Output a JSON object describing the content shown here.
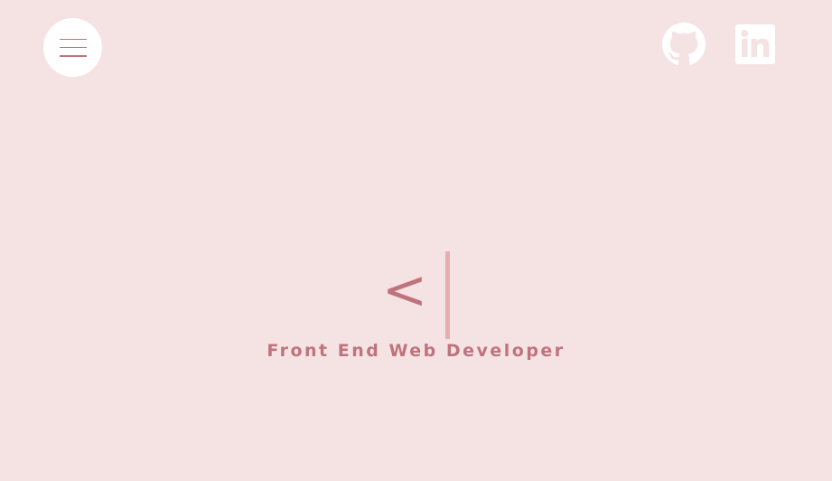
{
  "header": {
    "menu_button": {
      "icon": "hamburger-menu-icon"
    },
    "social_links": [
      {
        "name": "GitHub",
        "icon": "github-icon"
      },
      {
        "name": "LinkedIn",
        "icon": "linkedin-icon"
      }
    ]
  },
  "hero": {
    "typed_text": "<",
    "subtitle": "Front End Web Developer"
  },
  "colors": {
    "background": "#f5e3e4",
    "accent": "#c0737c",
    "cursor": "#e3aeb4",
    "white": "#ffffff"
  }
}
